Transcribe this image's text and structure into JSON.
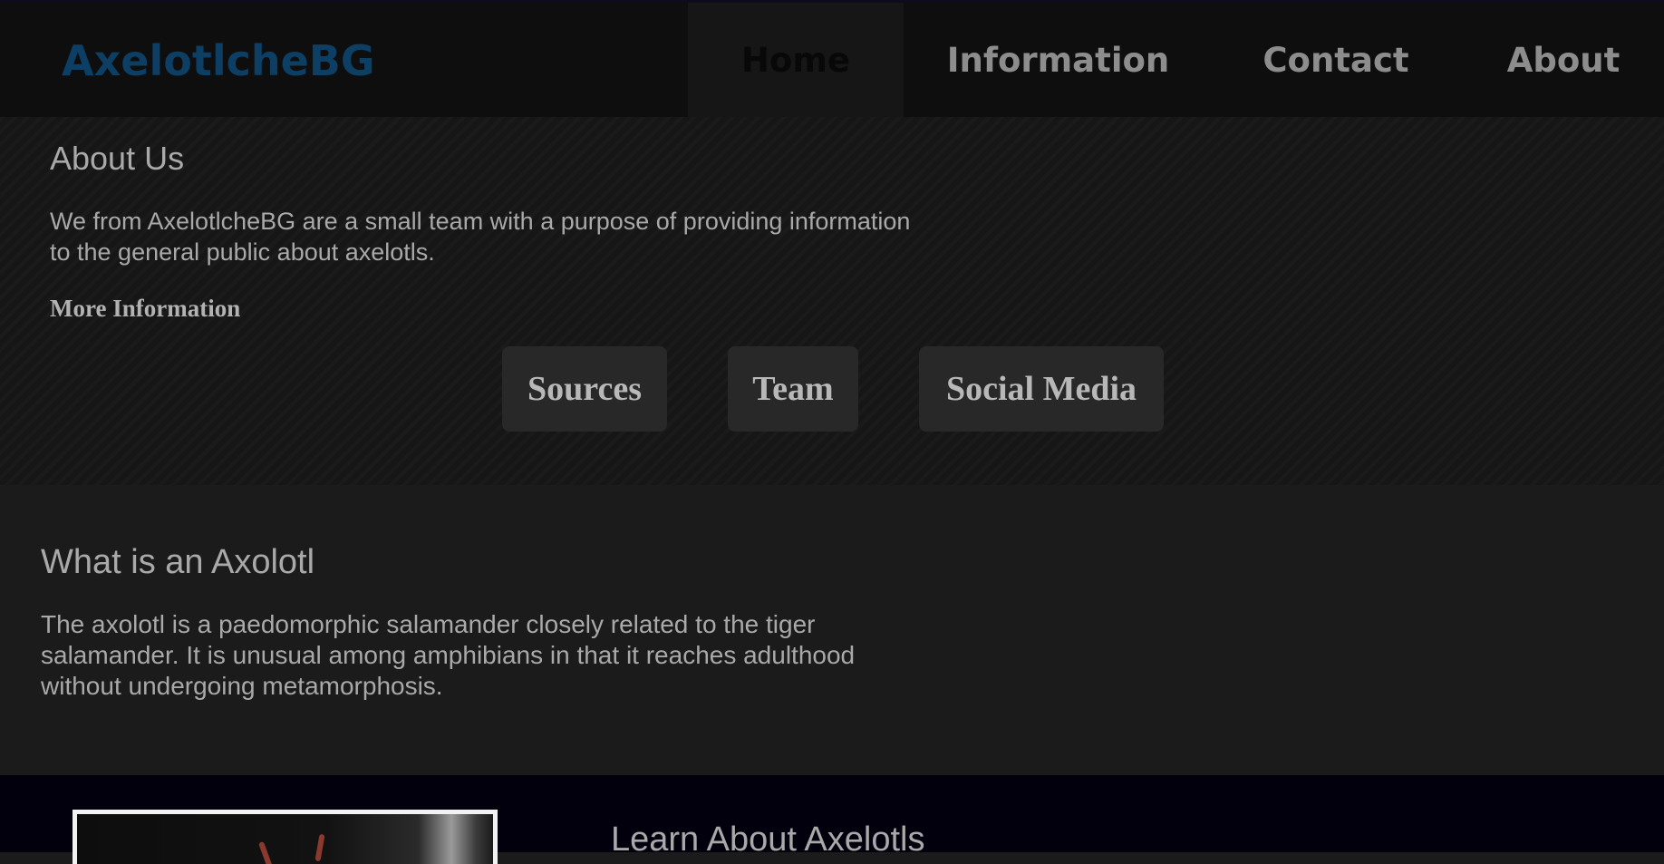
{
  "nav": {
    "brand": "AxelotlcheBG",
    "items": [
      {
        "label": "Home",
        "active": true
      },
      {
        "label": "Information"
      },
      {
        "label": "Contact"
      },
      {
        "label": "About"
      }
    ]
  },
  "about": {
    "title": "About Us",
    "text": "We from AxelotlcheBG are a small team with a purpose of providing information to the general public about axelotls.",
    "more_info": "More Information",
    "buttons": [
      "Sources",
      "Team",
      "Social Media"
    ]
  },
  "whatis": {
    "title": "What is an Axolotl",
    "text": "The axolotl is a paedomorphic salamander closely related to the tiger salamander. It is unusual among amphibians in that it reaches adulthood without undergoing metamorphosis."
  },
  "learn": {
    "title": "Learn About Axelotls"
  },
  "colors": {
    "brand": "#0c3f63",
    "nav_bg": "#0e0e0e",
    "page_bg": "#1b1b1b",
    "learn_bg": "#03000e",
    "text": "#a9a9a9"
  }
}
